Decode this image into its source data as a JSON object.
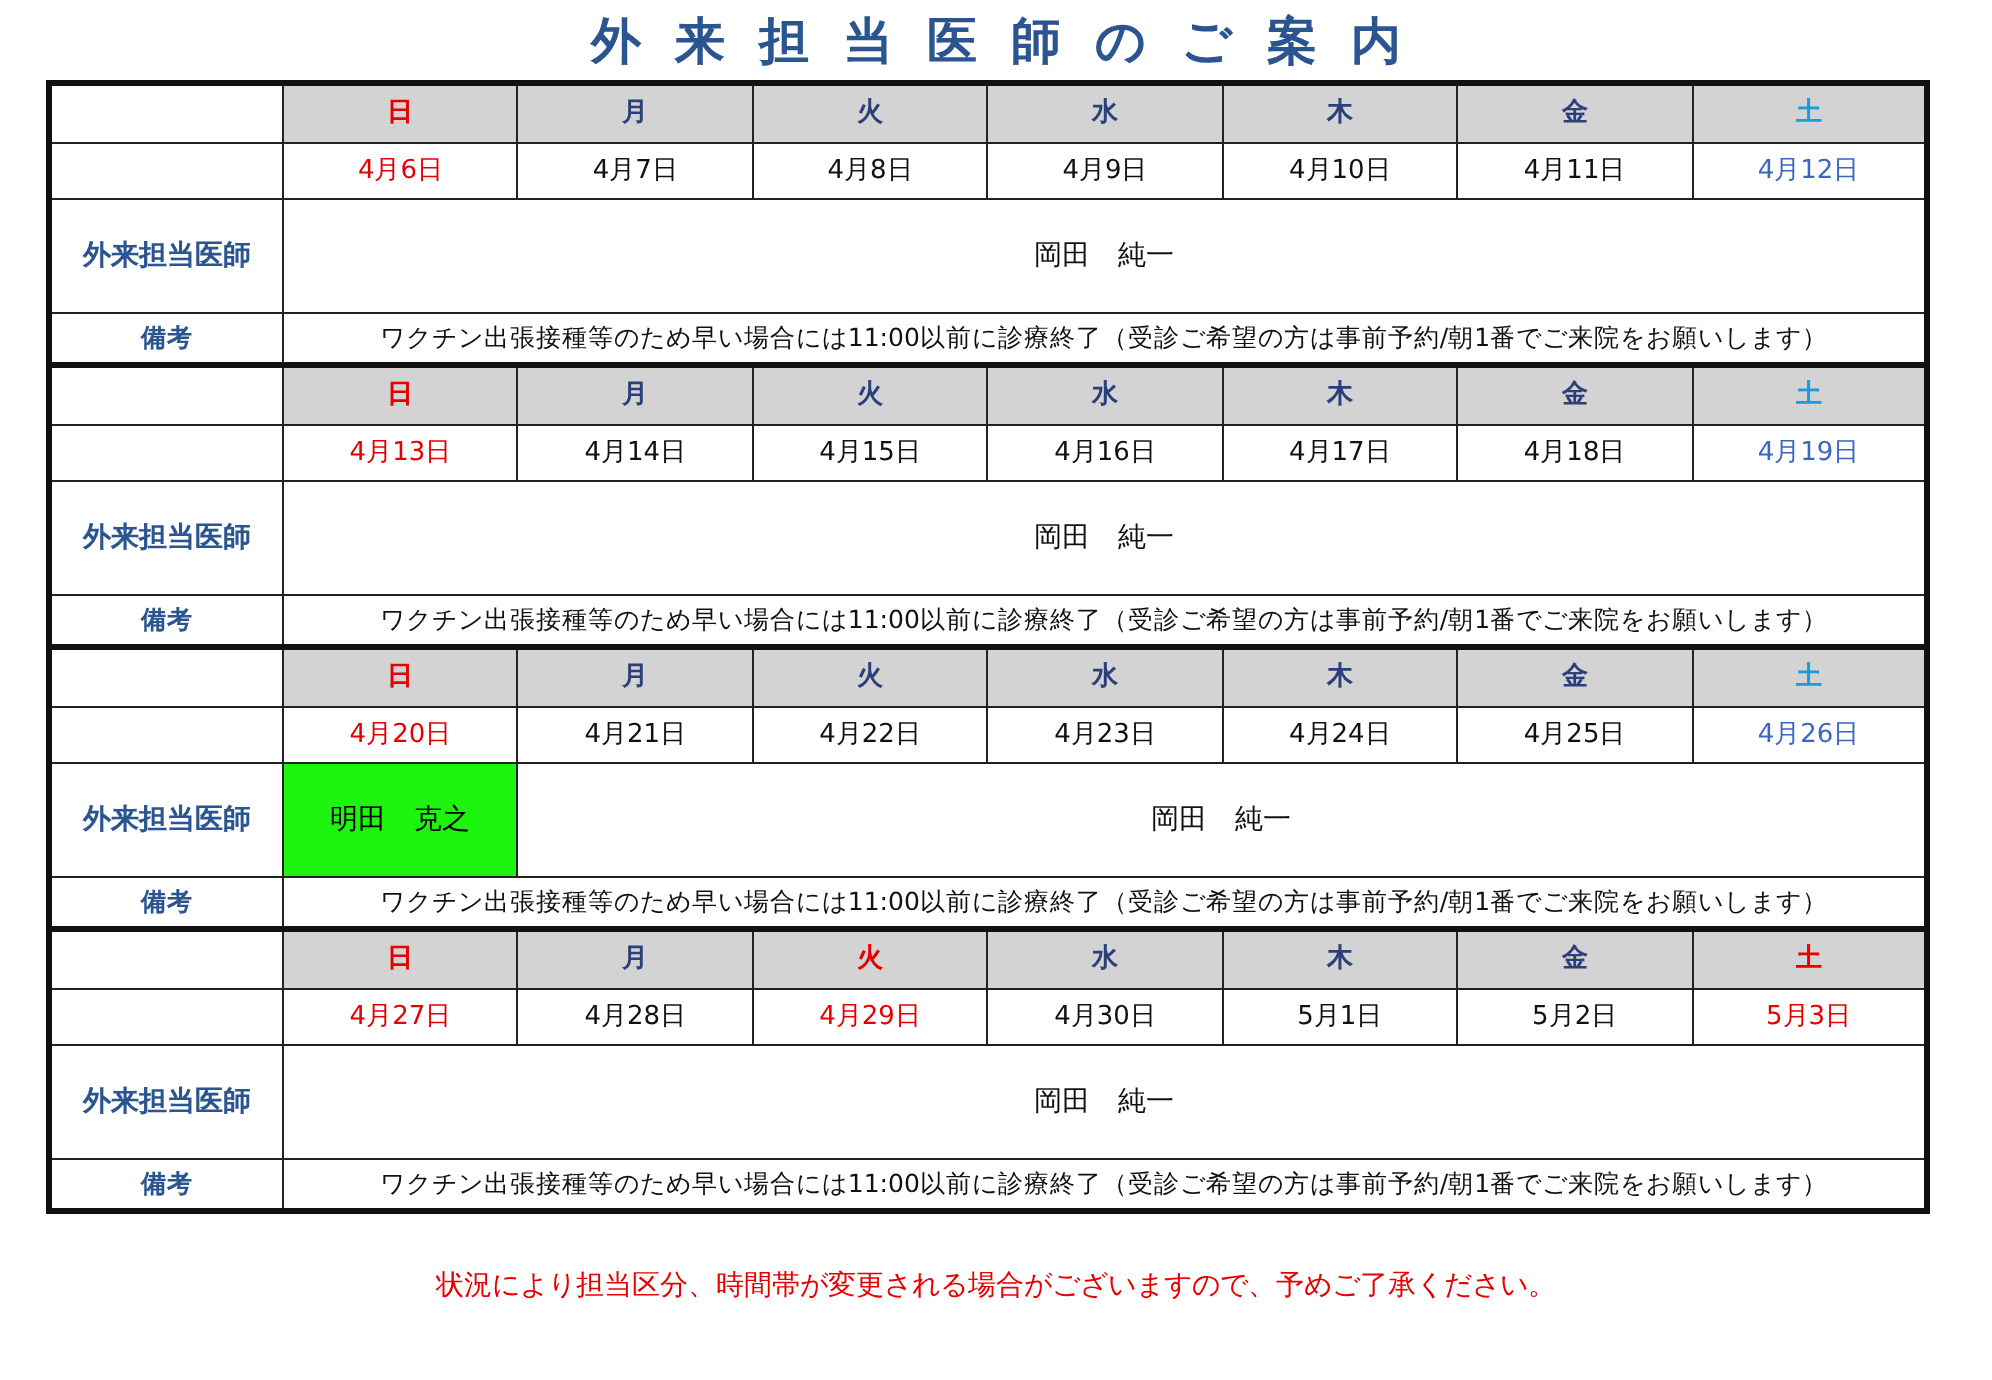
{
  "title": "外来担当医師のご案内",
  "weeks": [
    {
      "days": [
        {
          "weekday": "日",
          "date": "4月6日",
          "kind": "holiday"
        },
        {
          "weekday": "月",
          "date": "4月7日",
          "kind": "weekday"
        },
        {
          "weekday": "火",
          "date": "4月8日",
          "kind": "weekday"
        },
        {
          "weekday": "水",
          "date": "4月9日",
          "kind": "weekday"
        },
        {
          "weekday": "木",
          "date": "4月10日",
          "kind": "weekday"
        },
        {
          "weekday": "金",
          "date": "4月11日",
          "kind": "weekday"
        },
        {
          "weekday": "土",
          "date": "4月12日",
          "kind": "saturday"
        }
      ],
      "doctor_label": "外来担当医師",
      "doctors": [
        {
          "name": "岡田　純一",
          "highlighted": false
        }
      ],
      "note_label": "備考",
      "note": "ワクチン出張接種等のため早い場合には11:00以前に診療終了（受診ご希望の方は事前予約/朝1番でご来院をお願いします）"
    },
    {
      "days": [
        {
          "weekday": "日",
          "date": "4月13日",
          "kind": "holiday"
        },
        {
          "weekday": "月",
          "date": "4月14日",
          "kind": "weekday"
        },
        {
          "weekday": "火",
          "date": "4月15日",
          "kind": "weekday"
        },
        {
          "weekday": "水",
          "date": "4月16日",
          "kind": "weekday"
        },
        {
          "weekday": "木",
          "date": "4月17日",
          "kind": "weekday"
        },
        {
          "weekday": "金",
          "date": "4月18日",
          "kind": "weekday"
        },
        {
          "weekday": "土",
          "date": "4月19日",
          "kind": "saturday"
        }
      ],
      "doctor_label": "外来担当医師",
      "doctors": [
        {
          "name": "岡田　純一",
          "highlighted": false
        }
      ],
      "note_label": "備考",
      "note": "ワクチン出張接種等のため早い場合には11:00以前に診療終了（受診ご希望の方は事前予約/朝1番でご来院をお願いします）"
    },
    {
      "days": [
        {
          "weekday": "日",
          "date": "4月20日",
          "kind": "holiday"
        },
        {
          "weekday": "月",
          "date": "4月21日",
          "kind": "weekday"
        },
        {
          "weekday": "火",
          "date": "4月22日",
          "kind": "weekday"
        },
        {
          "weekday": "水",
          "date": "4月23日",
          "kind": "weekday"
        },
        {
          "weekday": "木",
          "date": "4月24日",
          "kind": "weekday"
        },
        {
          "weekday": "金",
          "date": "4月25日",
          "kind": "weekday"
        },
        {
          "weekday": "土",
          "date": "4月26日",
          "kind": "saturday"
        }
      ],
      "doctor_label": "外来担当医師",
      "doctors": [
        {
          "name": "明田　克之",
          "highlighted": true
        },
        {
          "name": "岡田　純一",
          "highlighted": false
        }
      ],
      "note_label": "備考",
      "note": "ワクチン出張接種等のため早い場合には11:00以前に診療終了（受診ご希望の方は事前予約/朝1番でご来院をお願いします）"
    },
    {
      "days": [
        {
          "weekday": "日",
          "date": "4月27日",
          "kind": "holiday"
        },
        {
          "weekday": "月",
          "date": "4月28日",
          "kind": "weekday"
        },
        {
          "weekday": "火",
          "date": "4月29日",
          "kind": "holiday"
        },
        {
          "weekday": "水",
          "date": "4月30日",
          "kind": "weekday"
        },
        {
          "weekday": "木",
          "date": "5月1日",
          "kind": "weekday"
        },
        {
          "weekday": "金",
          "date": "5月2日",
          "kind": "weekday"
        },
        {
          "weekday": "土",
          "date": "5月3日",
          "kind": "holiday"
        }
      ],
      "doctor_label": "外来担当医師",
      "doctors": [
        {
          "name": "岡田　純一",
          "highlighted": false
        }
      ],
      "note_label": "備考",
      "note": "ワクチン出張接種等のため早い場合には11:00以前に診療終了（受診ご希望の方は事前予約/朝1番でご来院をお願いします）"
    }
  ],
  "footer": "状況により担当区分、時間帯が変更される場合がございますので、予めご了承ください。"
}
